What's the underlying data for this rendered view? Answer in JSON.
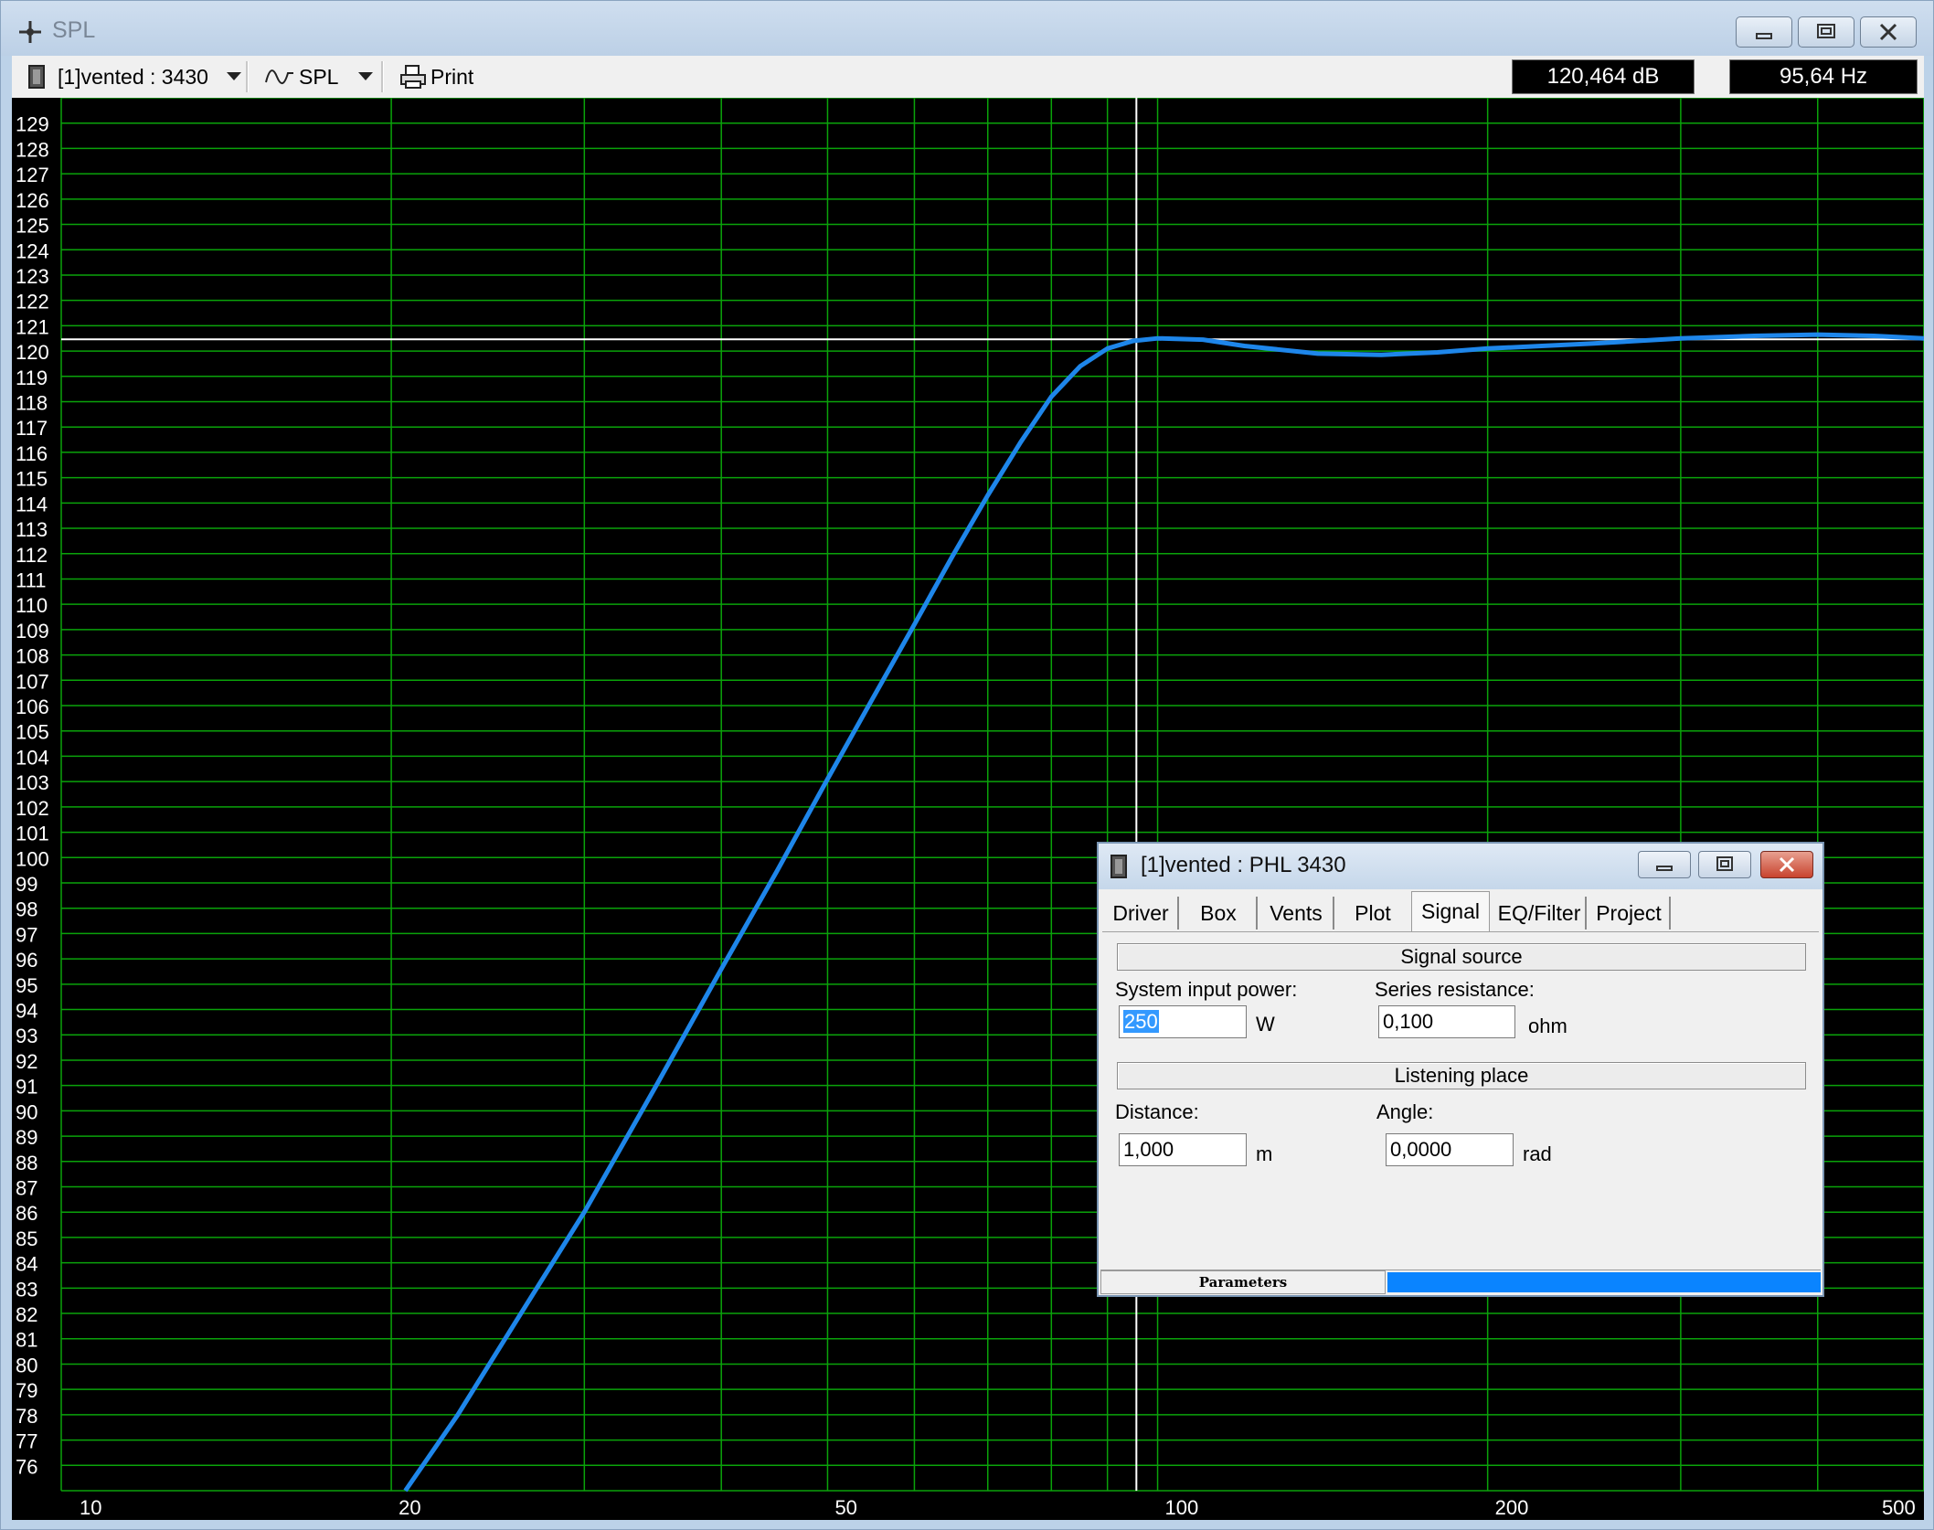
{
  "window": {
    "title": "SPL"
  },
  "toolbar": {
    "project_selector": "[1]vented : 3430",
    "plot_selector": "SPL",
    "print_label": "Print",
    "readout_db": "120,464 dB",
    "readout_hz": "95,64 Hz"
  },
  "chart_data": {
    "type": "line",
    "x_scale": "log",
    "xlim": [
      10,
      500
    ],
    "ylim": [
      75,
      130
    ],
    "x_tick_labels": [
      "10",
      "20",
      "50",
      "100",
      "200",
      "500"
    ],
    "x_tick_values": [
      10,
      20,
      50,
      100,
      200,
      500
    ],
    "y_tick_labels": [
      "129",
      "128",
      "127",
      "126",
      "125",
      "124",
      "123",
      "122",
      "121",
      "120",
      "119",
      "118",
      "117",
      "116",
      "115",
      "114",
      "113",
      "112",
      "111",
      "110",
      "109",
      "108",
      "107",
      "106",
      "105",
      "104",
      "103",
      "102",
      "101",
      "100",
      "99",
      "98",
      "97",
      "96",
      "95",
      "94",
      "93",
      "92",
      "91",
      "90",
      "89",
      "88",
      "87",
      "86",
      "85",
      "84",
      "83",
      "82",
      "81",
      "80",
      "79",
      "78",
      "77",
      "76"
    ],
    "grid": true,
    "cursor": {
      "x": 95.64,
      "y": 120.464
    },
    "series": [
      {
        "color": "#1e86ea",
        "x": [
          20.6,
          23,
          26,
          30,
          35,
          40,
          45,
          50,
          55,
          60,
          65,
          70,
          75,
          80,
          85,
          90,
          95,
          100,
          110,
          120,
          140,
          160,
          180,
          200,
          250,
          300,
          350,
          400,
          450,
          500
        ],
        "y": [
          75,
          78,
          81.7,
          86,
          91.1,
          95.6,
          99.5,
          103.1,
          106.3,
          109.2,
          111.9,
          114.3,
          116.4,
          118.2,
          119.4,
          120.1,
          120.4,
          120.5,
          120.45,
          120.2,
          119.9,
          119.85,
          119.95,
          120.1,
          120.3,
          120.5,
          120.6,
          120.65,
          120.6,
          120.5
        ]
      }
    ]
  },
  "dialog": {
    "title": "[1]vented : PHL 3430",
    "tabs": [
      "Driver",
      "Box",
      "Vents",
      "Plot",
      "Signal",
      "EQ/Filter",
      "Project"
    ],
    "active_tab": "Signal",
    "signal_source_head": "Signal source",
    "system_input_power_label": "System input power:",
    "system_input_power_value": "250",
    "system_input_power_unit": "W",
    "series_resistance_label": "Series resistance:",
    "series_resistance_value": "0,100",
    "series_resistance_unit": "ohm",
    "listening_place_head": "Listening place",
    "distance_label": "Distance:",
    "distance_value": "1,000",
    "distance_unit": "m",
    "angle_label": "Angle:",
    "angle_value": "0,0000",
    "angle_unit": "rad",
    "status_label": "Parameters"
  }
}
